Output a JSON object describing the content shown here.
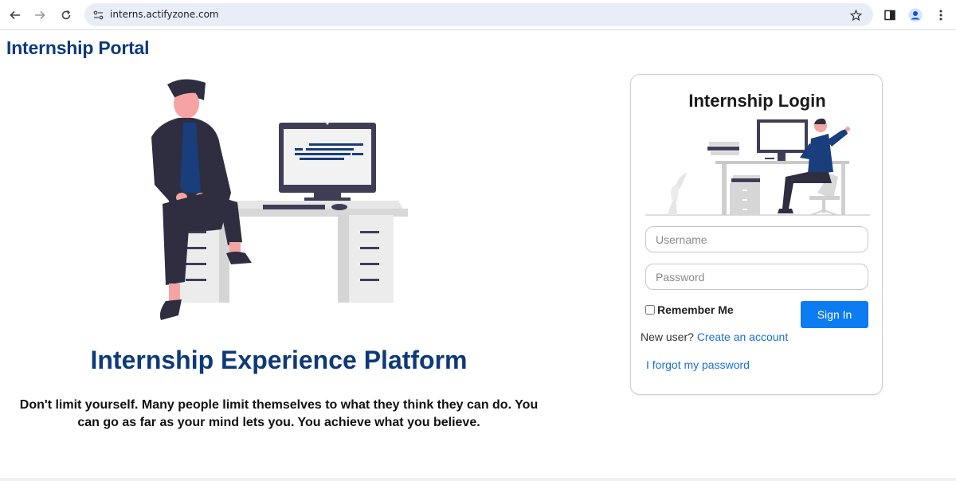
{
  "browser": {
    "url": "interns.actifyzone.com"
  },
  "page": {
    "portal_title": "Internship Portal",
    "platform_title": "Internship Experience Platform",
    "tagline": "Don't limit yourself. Many people limit themselves to what they think they can do. You can go as far as your mind lets you. You achieve what you believe."
  },
  "login": {
    "title": "Internship Login",
    "username_placeholder": "Username",
    "password_placeholder": "Password",
    "remember_label": "Remember Me",
    "signin_label": "Sign In",
    "new_user_text": "New user?",
    "create_account_label": "Create an account",
    "forgot_label": "I forgot my password"
  },
  "colors": {
    "brand": "#0d3a78",
    "button": "#0d7cf2",
    "link": "#1a6fd6"
  }
}
